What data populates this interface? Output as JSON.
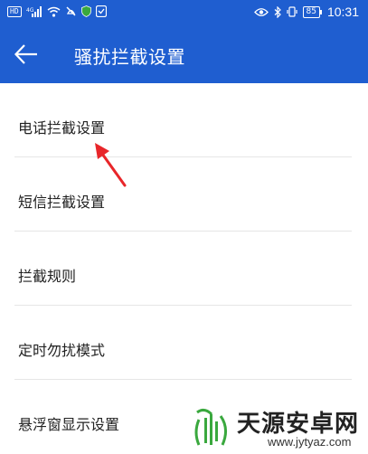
{
  "status_bar": {
    "hd_badge": "HD",
    "signal_label": "4G",
    "battery_level": "85",
    "time": "10:31"
  },
  "app_bar": {
    "title": "骚扰拦截设置"
  },
  "settings": {
    "items": [
      {
        "label": "电话拦截设置"
      },
      {
        "label": "短信拦截设置"
      },
      {
        "label": "拦截规则"
      },
      {
        "label": "定时勿扰模式"
      },
      {
        "label": "悬浮窗显示设置"
      }
    ]
  },
  "watermark": {
    "name": "天源安卓网",
    "url": "www.jytyaz.com"
  },
  "colors": {
    "primary": "#1f5ed0",
    "annotation": "#e8262a",
    "watermark_green": "#3aa83e"
  }
}
